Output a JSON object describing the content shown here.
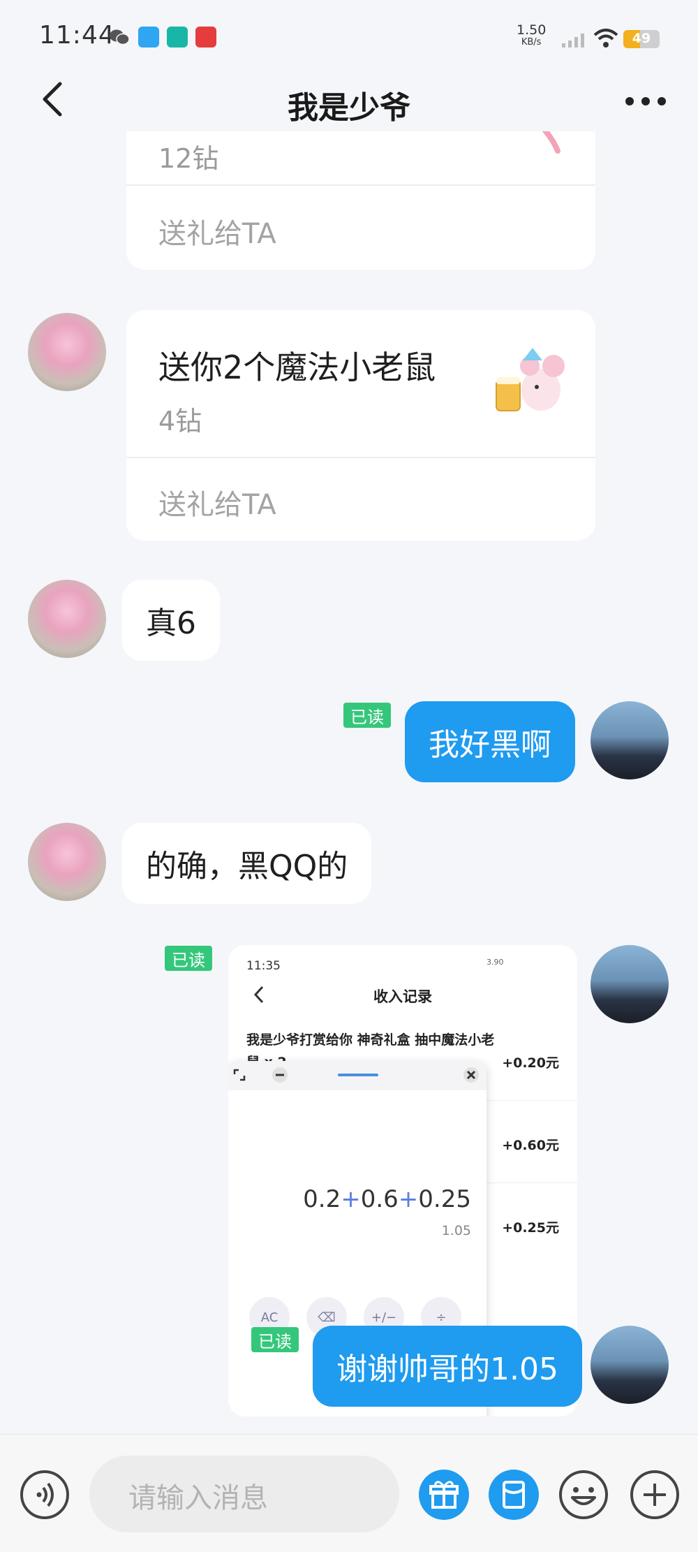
{
  "status_bar": {
    "time": "11:44",
    "net_speed_value": "1.50",
    "net_speed_unit": "KB/s",
    "battery": "49",
    "app_icons": [
      "wechat-icon",
      "blue-app-icon",
      "boss-zhipin-icon",
      "red-heart-app-icon"
    ]
  },
  "nav": {
    "title": "我是少爷"
  },
  "messages": {
    "gift1": {
      "price": "12钻",
      "action": "送礼给TA"
    },
    "gift2": {
      "title": "送你2个魔法小老鼠",
      "price": "4钻",
      "action": "送礼给TA"
    },
    "msg1": {
      "text": "真6"
    },
    "msg2": {
      "text": "我好黑啊",
      "read": "已读"
    },
    "msg3": {
      "text": "的确，黑QQ的"
    },
    "msg4": {
      "read": "已读"
    },
    "msg5": {
      "text": "谢谢帅哥的1.05",
      "read": "已读"
    }
  },
  "screenshot": {
    "time": "11:35",
    "speed": "3.90",
    "title": "收入记录",
    "description": "我是少爷打赏给你 神奇礼盒 抽中魔法小老鼠 x 2",
    "amounts": [
      "+0.20元",
      "+0.60元",
      "+0.25元"
    ],
    "calculator": {
      "n1": "0.2",
      "n2": "0.6",
      "n3": "0.25",
      "op": "+",
      "result": "1.05",
      "keys": [
        "AC",
        "⌫",
        "+/−",
        "÷"
      ]
    }
  },
  "input_bar": {
    "placeholder": "请输入消息"
  },
  "colors": {
    "accent_blue": "#1f9bf0",
    "read_green": "#34c77b",
    "background": "#f4f6f9"
  }
}
